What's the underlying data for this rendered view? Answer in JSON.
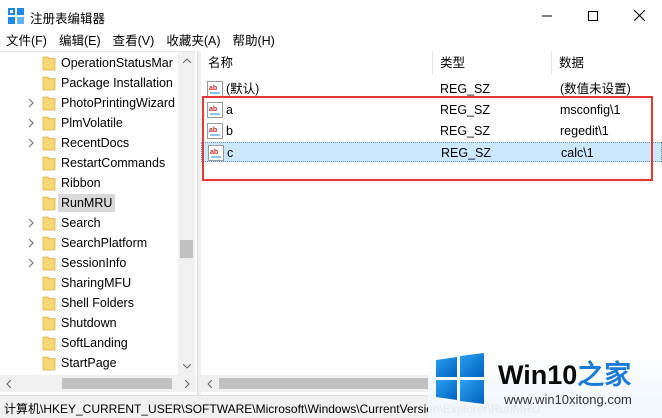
{
  "window": {
    "title": "注册表编辑器",
    "accent_color": "#0078d7"
  },
  "menu": [
    {
      "label": "文件(F)"
    },
    {
      "label": "编辑(E)"
    },
    {
      "label": "查看(V)"
    },
    {
      "label": "收藏夹(A)"
    },
    {
      "label": "帮助(H)"
    }
  ],
  "tree": {
    "items": [
      {
        "label": "OperationStatusMar",
        "expandable": false
      },
      {
        "label": "Package Installation",
        "expandable": false
      },
      {
        "label": "PhotoPrintingWizard",
        "expandable": true
      },
      {
        "label": "PlmVolatile",
        "expandable": true
      },
      {
        "label": "RecentDocs",
        "expandable": true
      },
      {
        "label": "RestartCommands",
        "expandable": false
      },
      {
        "label": "Ribbon",
        "expandable": false
      },
      {
        "label": "RunMRU",
        "expandable": false,
        "selected": true
      },
      {
        "label": "Search",
        "expandable": true
      },
      {
        "label": "SearchPlatform",
        "expandable": true
      },
      {
        "label": "SessionInfo",
        "expandable": true
      },
      {
        "label": "SharingMFU",
        "expandable": false
      },
      {
        "label": "Shell Folders",
        "expandable": false
      },
      {
        "label": "Shutdown",
        "expandable": false
      },
      {
        "label": "SoftLanding",
        "expandable": false
      },
      {
        "label": "StartPage",
        "expandable": false
      }
    ]
  },
  "columns": {
    "name": "名称",
    "type": "类型",
    "data": "数据"
  },
  "values": [
    {
      "name": "(默认)",
      "type": "REG_SZ",
      "data": "(数值未设置)",
      "selected": false
    },
    {
      "name": "a",
      "type": "REG_SZ",
      "data": "msconfig\\1",
      "selected": false
    },
    {
      "name": "b",
      "type": "REG_SZ",
      "data": "regedit\\1",
      "selected": false
    },
    {
      "name": "c",
      "type": "REG_SZ",
      "data": "calc\\1",
      "selected": true
    }
  ],
  "status": {
    "path": "计算机\\HKEY_CURRENT_USER\\SOFTWARE\\Microsoft\\Windows\\CurrentVersion\\Explorer\\RunMRU"
  },
  "watermark": {
    "title_main": "Win10",
    "title_accent": "之家",
    "url": "www.win10xitong.com"
  },
  "colors": {
    "highlight_box": "#e53935",
    "selection": "#cce8ff",
    "folder": "#f8d775"
  }
}
